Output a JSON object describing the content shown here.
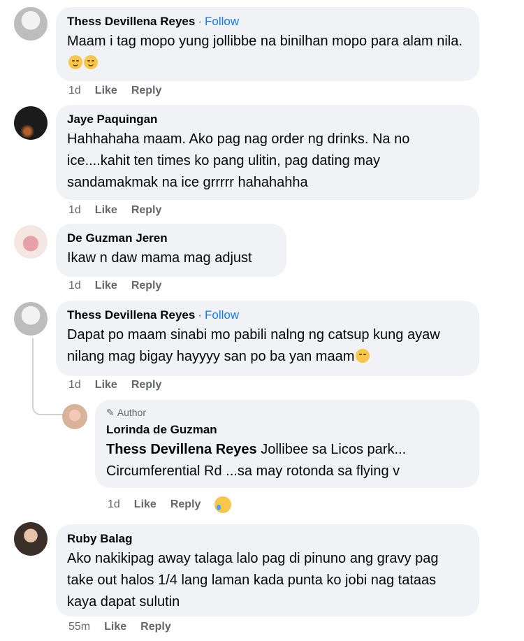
{
  "comments": [
    {
      "name": "Thess Devillena Reyes",
      "follow": "Follow",
      "text": "Maam i tag mopo yung jollibbe na binilhan mopo para alam nila.",
      "time": "1d",
      "like": "Like",
      "reply": "Reply"
    },
    {
      "name": "Jaye Paquingan",
      "text": "Hahhahaha maam. Ako pag nag order ng drinks. Na no ice....kahit ten times ko pang ulitin, pag dating may sandamakmak na ice grrrrr hahahahha",
      "time": "1d",
      "like": "Like",
      "reply": "Reply"
    },
    {
      "name": "De Guzman Jeren",
      "text": "Ikaw n daw mama mag adjust",
      "time": "1d",
      "like": "Like",
      "reply": "Reply"
    },
    {
      "name": "Thess Devillena Reyes",
      "follow": "Follow",
      "text": "Dapat po maam sinabi mo pabili nalng ng catsup kung ayaw nilang mag bigay hayyyy san po ba yan maam",
      "time": "1d",
      "like": "Like",
      "reply": "Reply"
    },
    {
      "badge": "Author",
      "name": "Lorinda de Guzman",
      "tag": "Thess Devillena Reyes",
      "text": " Jollibee sa Licos park... Circumferential Rd ...sa may rotonda sa flying v",
      "time": "1d",
      "like": "Like",
      "reply": "Reply"
    },
    {
      "name": "Ruby Balag",
      "text": "Ako nakikipag away talaga lalo pag di pinuno ang gravy pag take out halos 1/4 lang laman kada punta ko jobi nag tataas kaya dapat sulutin",
      "time": "55m",
      "like": "Like",
      "reply": "Reply"
    }
  ],
  "dot": "·"
}
